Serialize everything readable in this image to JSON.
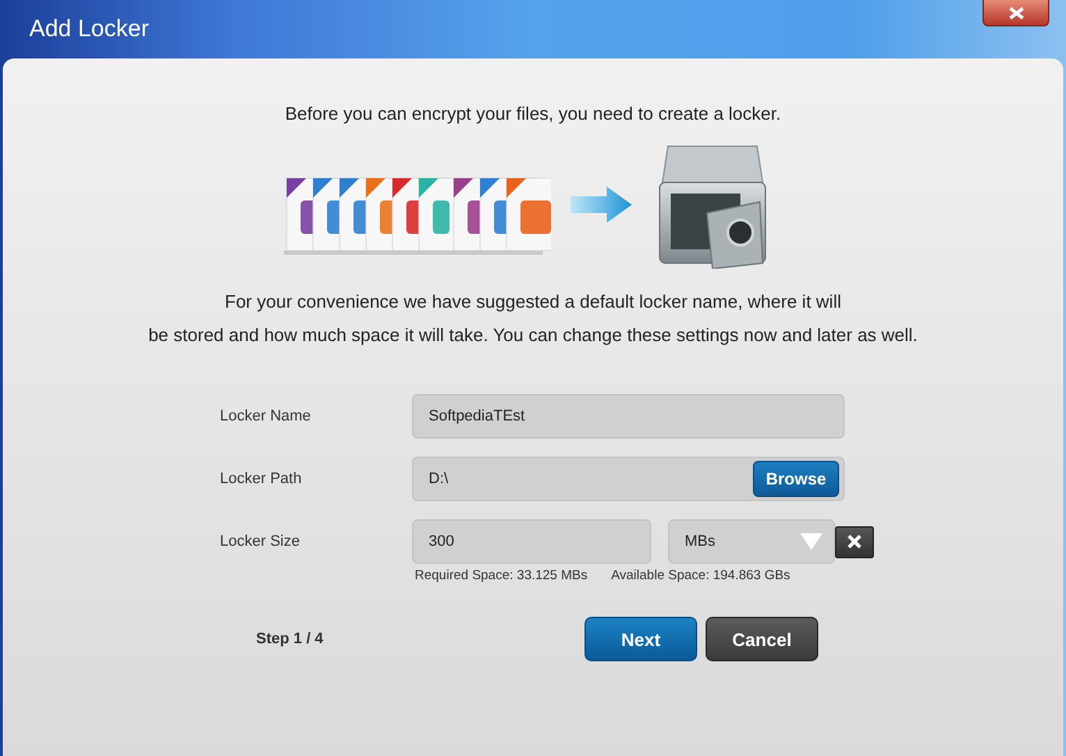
{
  "window": {
    "title": "Add Locker"
  },
  "intro": "Before you can encrypt your files, you need to create a locker.",
  "description_lines": [
    "For your convenience we have suggested a default locker name, where it will",
    "be stored and how much space it will take. You can change these settings now and later as well."
  ],
  "form": {
    "fields": [
      {
        "kind": "text",
        "label": "Locker Name",
        "value": "SoftpediaTEst"
      },
      {
        "kind": "path",
        "label": "Locker Path",
        "value": "D:\\",
        "button": "Browse"
      },
      {
        "kind": "size",
        "label": "Locker Size",
        "value": "300",
        "unit": "MBs",
        "required": "Required Space: 33.125 MBs",
        "available": "Available Space: 194.863 GBs"
      }
    ]
  },
  "step": "Step 1 / 4",
  "buttons": [
    {
      "kind": "primary",
      "label": "Next"
    },
    {
      "kind": "secondary",
      "label": "Cancel"
    }
  ]
}
